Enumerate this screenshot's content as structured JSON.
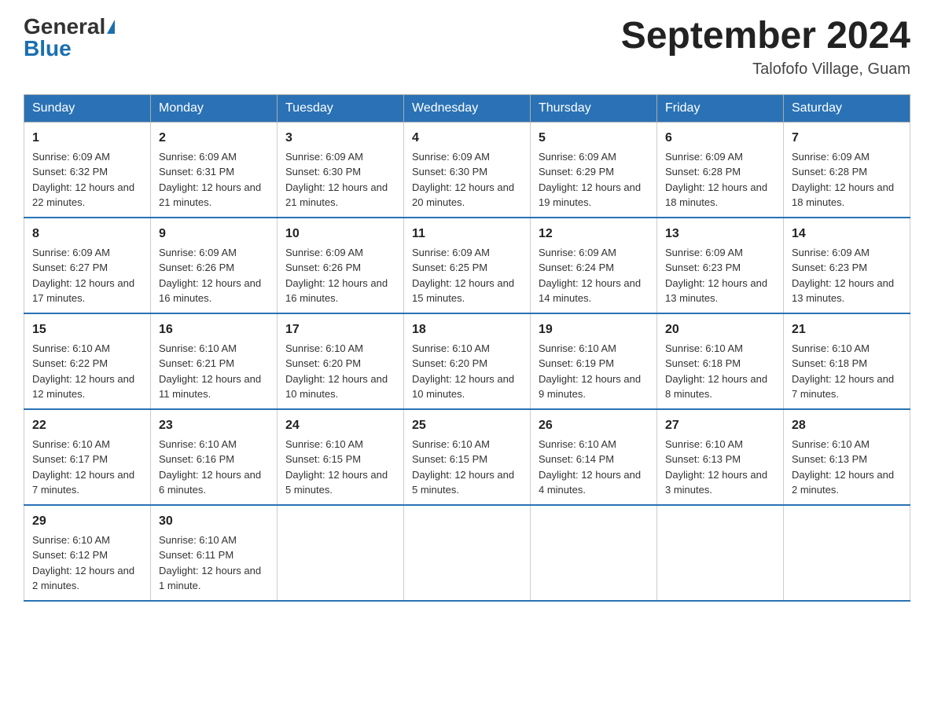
{
  "header": {
    "logo_general": "General",
    "logo_blue": "Blue",
    "month_title": "September 2024",
    "location": "Talofofo Village, Guam"
  },
  "days_of_week": [
    "Sunday",
    "Monday",
    "Tuesday",
    "Wednesday",
    "Thursday",
    "Friday",
    "Saturday"
  ],
  "weeks": [
    [
      {
        "day": "1",
        "sunrise": "6:09 AM",
        "sunset": "6:32 PM",
        "daylight": "12 hours and 22 minutes."
      },
      {
        "day": "2",
        "sunrise": "6:09 AM",
        "sunset": "6:31 PM",
        "daylight": "12 hours and 21 minutes."
      },
      {
        "day": "3",
        "sunrise": "6:09 AM",
        "sunset": "6:30 PM",
        "daylight": "12 hours and 21 minutes."
      },
      {
        "day": "4",
        "sunrise": "6:09 AM",
        "sunset": "6:30 PM",
        "daylight": "12 hours and 20 minutes."
      },
      {
        "day": "5",
        "sunrise": "6:09 AM",
        "sunset": "6:29 PM",
        "daylight": "12 hours and 19 minutes."
      },
      {
        "day": "6",
        "sunrise": "6:09 AM",
        "sunset": "6:28 PM",
        "daylight": "12 hours and 18 minutes."
      },
      {
        "day": "7",
        "sunrise": "6:09 AM",
        "sunset": "6:28 PM",
        "daylight": "12 hours and 18 minutes."
      }
    ],
    [
      {
        "day": "8",
        "sunrise": "6:09 AM",
        "sunset": "6:27 PM",
        "daylight": "12 hours and 17 minutes."
      },
      {
        "day": "9",
        "sunrise": "6:09 AM",
        "sunset": "6:26 PM",
        "daylight": "12 hours and 16 minutes."
      },
      {
        "day": "10",
        "sunrise": "6:09 AM",
        "sunset": "6:26 PM",
        "daylight": "12 hours and 16 minutes."
      },
      {
        "day": "11",
        "sunrise": "6:09 AM",
        "sunset": "6:25 PM",
        "daylight": "12 hours and 15 minutes."
      },
      {
        "day": "12",
        "sunrise": "6:09 AM",
        "sunset": "6:24 PM",
        "daylight": "12 hours and 14 minutes."
      },
      {
        "day": "13",
        "sunrise": "6:09 AM",
        "sunset": "6:23 PM",
        "daylight": "12 hours and 13 minutes."
      },
      {
        "day": "14",
        "sunrise": "6:09 AM",
        "sunset": "6:23 PM",
        "daylight": "12 hours and 13 minutes."
      }
    ],
    [
      {
        "day": "15",
        "sunrise": "6:10 AM",
        "sunset": "6:22 PM",
        "daylight": "12 hours and 12 minutes."
      },
      {
        "day": "16",
        "sunrise": "6:10 AM",
        "sunset": "6:21 PM",
        "daylight": "12 hours and 11 minutes."
      },
      {
        "day": "17",
        "sunrise": "6:10 AM",
        "sunset": "6:20 PM",
        "daylight": "12 hours and 10 minutes."
      },
      {
        "day": "18",
        "sunrise": "6:10 AM",
        "sunset": "6:20 PM",
        "daylight": "12 hours and 10 minutes."
      },
      {
        "day": "19",
        "sunrise": "6:10 AM",
        "sunset": "6:19 PM",
        "daylight": "12 hours and 9 minutes."
      },
      {
        "day": "20",
        "sunrise": "6:10 AM",
        "sunset": "6:18 PM",
        "daylight": "12 hours and 8 minutes."
      },
      {
        "day": "21",
        "sunrise": "6:10 AM",
        "sunset": "6:18 PM",
        "daylight": "12 hours and 7 minutes."
      }
    ],
    [
      {
        "day": "22",
        "sunrise": "6:10 AM",
        "sunset": "6:17 PM",
        "daylight": "12 hours and 7 minutes."
      },
      {
        "day": "23",
        "sunrise": "6:10 AM",
        "sunset": "6:16 PM",
        "daylight": "12 hours and 6 minutes."
      },
      {
        "day": "24",
        "sunrise": "6:10 AM",
        "sunset": "6:15 PM",
        "daylight": "12 hours and 5 minutes."
      },
      {
        "day": "25",
        "sunrise": "6:10 AM",
        "sunset": "6:15 PM",
        "daylight": "12 hours and 5 minutes."
      },
      {
        "day": "26",
        "sunrise": "6:10 AM",
        "sunset": "6:14 PM",
        "daylight": "12 hours and 4 minutes."
      },
      {
        "day": "27",
        "sunrise": "6:10 AM",
        "sunset": "6:13 PM",
        "daylight": "12 hours and 3 minutes."
      },
      {
        "day": "28",
        "sunrise": "6:10 AM",
        "sunset": "6:13 PM",
        "daylight": "12 hours and 2 minutes."
      }
    ],
    [
      {
        "day": "29",
        "sunrise": "6:10 AM",
        "sunset": "6:12 PM",
        "daylight": "12 hours and 2 minutes."
      },
      {
        "day": "30",
        "sunrise": "6:10 AM",
        "sunset": "6:11 PM",
        "daylight": "12 hours and 1 minute."
      },
      null,
      null,
      null,
      null,
      null
    ]
  ]
}
